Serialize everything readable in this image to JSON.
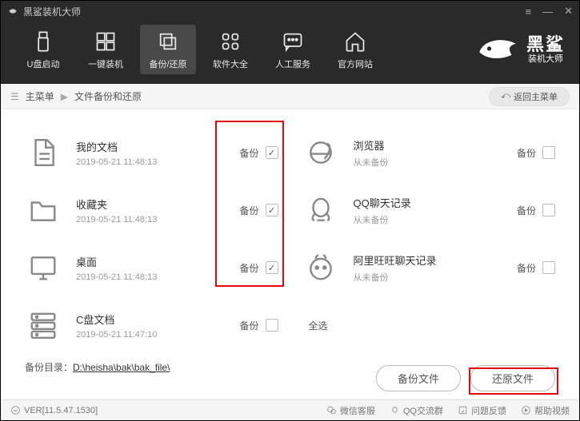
{
  "titlebar": {
    "app_name": "黑鲨装机大师"
  },
  "toolbar": {
    "items": [
      {
        "label": "U盘启动"
      },
      {
        "label": "一键装机"
      },
      {
        "label": "备份/还原"
      },
      {
        "label": "软件大全"
      },
      {
        "label": "人工服务"
      },
      {
        "label": "官方网站"
      }
    ]
  },
  "brand": {
    "big": "黑鲨",
    "small": "装机大师"
  },
  "breadcrumb": {
    "root": "主菜单",
    "current": "文件备份和还原",
    "back": "返回主菜单"
  },
  "items_left": [
    {
      "name": "我的文档",
      "date": "2019-05-21 11:48:13",
      "action": "备份",
      "checked": true
    },
    {
      "name": "收藏夹",
      "date": "2019-05-21 11:48:13",
      "action": "备份",
      "checked": true
    },
    {
      "name": "桌面",
      "date": "2019-05-21 11:48:13",
      "action": "备份",
      "checked": true
    },
    {
      "name": "C盘文档",
      "date": "2019-05-21 11:47:10",
      "action": "备份",
      "checked": false
    }
  ],
  "items_right": [
    {
      "name": "浏览器",
      "date": "从未备份",
      "action": "备份",
      "checked": false
    },
    {
      "name": "QQ聊天记录",
      "date": "从未备份",
      "action": "备份",
      "checked": false
    },
    {
      "name": "阿里旺旺聊天记录",
      "date": "从未备份",
      "action": "备份",
      "checked": false
    }
  ],
  "select_all": {
    "label": "全选",
    "checked": false
  },
  "backup_dir": {
    "label": "备份目录：",
    "path": "D:\\heisha\\bak\\bak_file\\"
  },
  "buttons": {
    "backup": "备份文件",
    "restore": "还原文件"
  },
  "statusbar": {
    "version": "VER[11.5.47.1530]",
    "items": [
      "微信客服",
      "QQ交流群",
      "问题反馈",
      "帮助视频"
    ]
  }
}
